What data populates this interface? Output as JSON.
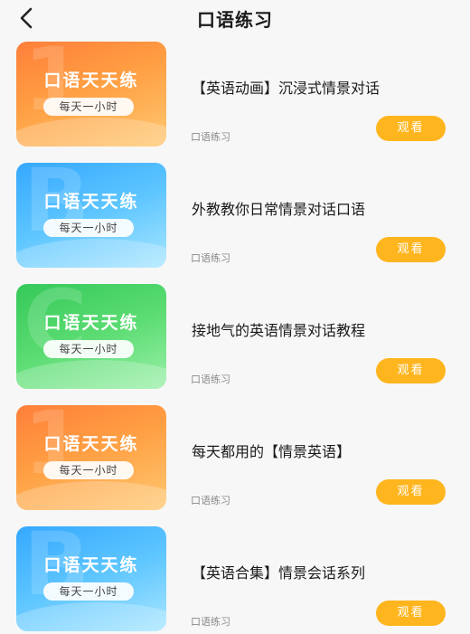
{
  "header": {
    "title": "口语练习",
    "back_icon": "chevron-left-icon"
  },
  "items": [
    {
      "title": "【英语动画】沉浸式情景对话",
      "tag": "口语练习",
      "button": "观看",
      "thumb": {
        "title": "口语天天练",
        "pill": "每天一小时",
        "glyph": "1",
        "theme": "orange"
      }
    },
    {
      "title": "外教教你日常情景对话口语",
      "tag": "口语练习",
      "button": "观看",
      "thumb": {
        "title": "口语天天练",
        "pill": "每天一小时",
        "glyph": "B",
        "theme": "blue"
      }
    },
    {
      "title": "接地气的英语情景对话教程",
      "tag": "口语练习",
      "button": "观看",
      "thumb": {
        "title": "口语天天练",
        "pill": "每天一小时",
        "glyph": "C",
        "theme": "green"
      }
    },
    {
      "title": "每天都用的【情景英语】",
      "tag": "口语练习",
      "button": "观看",
      "thumb": {
        "title": "口语天天练",
        "pill": "每天一小时",
        "glyph": "1",
        "theme": "orange"
      }
    },
    {
      "title": "【英语合集】情景会话系列",
      "tag": "口语练习",
      "button": "观看",
      "thumb": {
        "title": "口语天天练",
        "pill": "每天一小时",
        "glyph": "B",
        "theme": "blue"
      }
    }
  ],
  "colors": {
    "button": "#ffb51e",
    "background": "#f7f7f7",
    "orange_card": "#ff8f3f",
    "blue_card": "#4fbaff",
    "green_card": "#48d566"
  }
}
